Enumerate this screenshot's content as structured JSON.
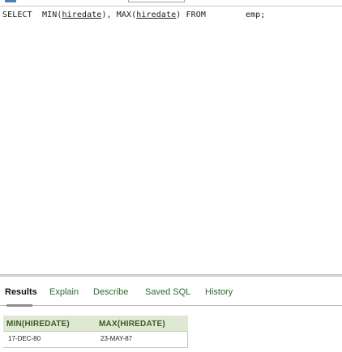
{
  "editor": {
    "sql": {
      "kw_select": "SELECT",
      "fn_min": "MIN(",
      "col1": "hiredate",
      "sep1": "), MAX(",
      "col2": "hiredate",
      "sep2": ") FROM",
      "table": "emp;"
    }
  },
  "results": {
    "tabs": [
      {
        "label": "Results",
        "active": true
      },
      {
        "label": "Explain",
        "active": false
      },
      {
        "label": "Describe",
        "active": false
      },
      {
        "label": "Saved SQL",
        "active": false
      },
      {
        "label": "History",
        "active": false
      }
    ],
    "columns": [
      "MIN(HIREDATE)",
      "MAX(HIREDATE)"
    ],
    "rows": [
      [
        "17-DEC-80",
        "23-MAY-87"
      ]
    ]
  },
  "colors": {
    "tab_text": "#2a6b2a",
    "header_bg": "#dfe8d3",
    "header_text": "#3b5a26"
  }
}
